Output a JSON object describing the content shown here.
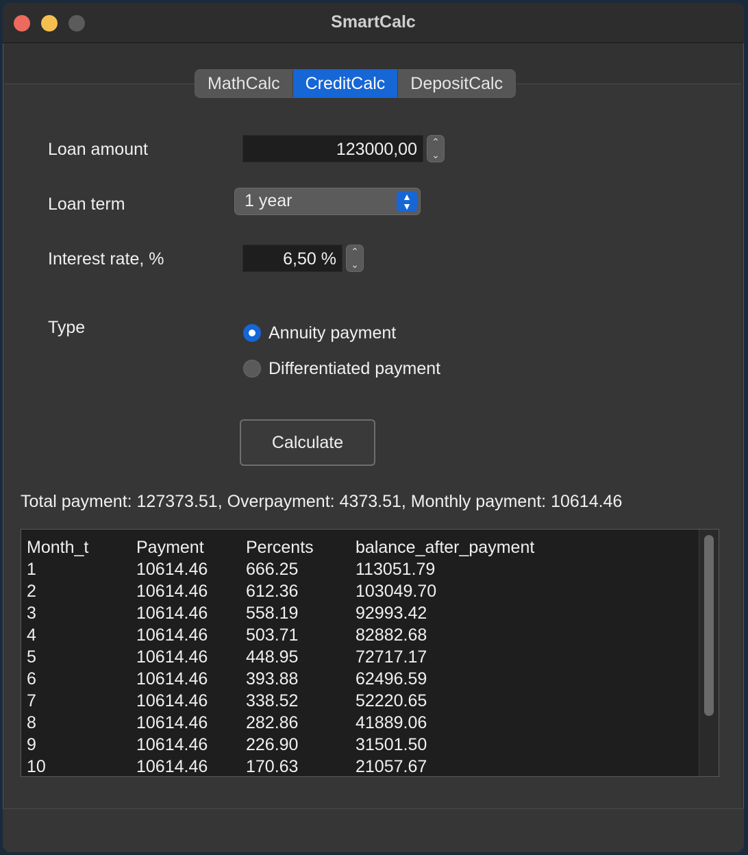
{
  "window": {
    "title": "SmartCalc"
  },
  "tabs": [
    {
      "label": "MathCalc",
      "active": false
    },
    {
      "label": "CreditCalc",
      "active": true
    },
    {
      "label": "DepositCalc",
      "active": false
    }
  ],
  "form": {
    "loan_amount_label": "Loan amount",
    "loan_amount_value": "123000,00",
    "loan_term_label": "Loan term",
    "loan_term_value": "1 year",
    "interest_label": "Interest rate, %",
    "interest_value": "6,50 %",
    "type_label": "Type",
    "radio_annuity": "Annuity payment",
    "radio_differentiated": "Differentiated payment",
    "selected_type": "annuity",
    "calculate_label": "Calculate"
  },
  "summary": "Total payment: 127373.51, Overpayment: 4373.51, Monthly payment: 10614.46",
  "table": {
    "headers": [
      "Month_t",
      "Payment",
      "Percents",
      "balance_after_payment"
    ],
    "rows": [
      [
        "1",
        "10614.46",
        "666.25",
        "113051.79"
      ],
      [
        "2",
        "10614.46",
        "612.36",
        "103049.70"
      ],
      [
        "3",
        "10614.46",
        "558.19",
        "92993.42"
      ],
      [
        "4",
        "10614.46",
        "503.71",
        "82882.68"
      ],
      [
        "5",
        "10614.46",
        "448.95",
        "72717.17"
      ],
      [
        "6",
        "10614.46",
        "393.88",
        "62496.59"
      ],
      [
        "7",
        "10614.46",
        "338.52",
        "52220.65"
      ],
      [
        "8",
        "10614.46",
        "282.86",
        "41889.06"
      ],
      [
        "9",
        "10614.46",
        "226.90",
        "31501.50"
      ],
      [
        "10",
        "10614.46",
        "170.63",
        "21057.67"
      ]
    ]
  },
  "colors": {
    "accent": "#1666d6",
    "window_bg": "#323232",
    "field_bg": "#1e1e1e"
  },
  "icons": {
    "stepper": "chevron-up-down-icon",
    "select": "chevron-up-down-icon"
  }
}
